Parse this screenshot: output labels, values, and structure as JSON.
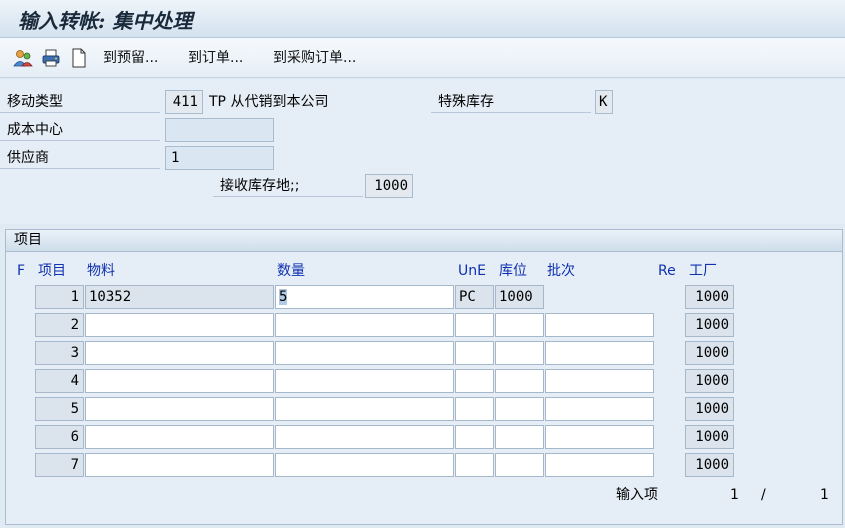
{
  "window": {
    "title": "输入转帐: 集中处理"
  },
  "toolbar": {
    "buttons": [
      "到预留...",
      "到订单...",
      "到采购订单..."
    ],
    "icons": [
      "person-icon",
      "printer-icon",
      "document-icon"
    ]
  },
  "header": {
    "movement_type": {
      "label": "移动类型",
      "value": "411",
      "description": "TP 从代销到本公司"
    },
    "special_stock": {
      "label": "特殊库存",
      "value": "K"
    },
    "cost_center": {
      "label": "成本中心",
      "value": ""
    },
    "vendor": {
      "label": "供应商",
      "value": "1"
    },
    "receiving_sloc": {
      "label": "接收库存地;;",
      "value": "1000"
    }
  },
  "items": {
    "section_title": "项目",
    "columns": [
      "F",
      "项目",
      "物料",
      "数量",
      "UnE",
      "库位",
      "批次",
      "Re",
      "工厂"
    ],
    "rows": [
      {
        "item": "1",
        "material": "10352",
        "quantity": "5",
        "unit": "PC",
        "sloc": "1000",
        "batch": "",
        "plant": "1000"
      },
      {
        "item": "2",
        "material": "",
        "quantity": "",
        "unit": "",
        "sloc": "",
        "batch": "",
        "plant": "1000"
      },
      {
        "item": "3",
        "material": "",
        "quantity": "",
        "unit": "",
        "sloc": "",
        "batch": "",
        "plant": "1000"
      },
      {
        "item": "4",
        "material": "",
        "quantity": "",
        "unit": "",
        "sloc": "",
        "batch": "",
        "plant": "1000"
      },
      {
        "item": "5",
        "material": "",
        "quantity": "",
        "unit": "",
        "sloc": "",
        "batch": "",
        "plant": "1000"
      },
      {
        "item": "6",
        "material": "",
        "quantity": "",
        "unit": "",
        "sloc": "",
        "batch": "",
        "plant": "1000"
      },
      {
        "item": "7",
        "material": "",
        "quantity": "",
        "unit": "",
        "sloc": "",
        "batch": "",
        "plant": "1000"
      }
    ],
    "footer": {
      "label": "输入项",
      "current": "1",
      "separator": "/",
      "total": "1"
    }
  },
  "colors": {
    "accent": "#1030b0",
    "background": "#dfeaf3"
  }
}
